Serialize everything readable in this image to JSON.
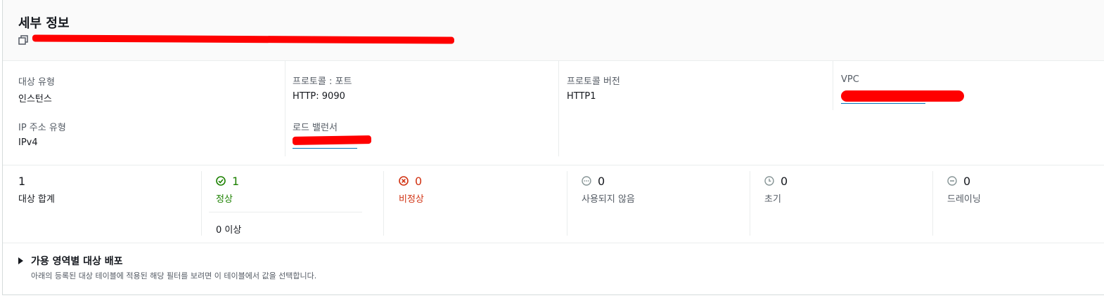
{
  "header": {
    "title": "세부 정보"
  },
  "details": {
    "target_type": {
      "label": "대상 유형",
      "value": "인스턴스"
    },
    "ip_address_type": {
      "label": "IP 주소 유형",
      "value": "IPv4"
    },
    "protocol_port": {
      "label": "프로토콜 : 포트",
      "value": "HTTP: 9090"
    },
    "load_balancer": {
      "label": "로드 밸런서"
    },
    "protocol_version": {
      "label": "프로토콜 버전",
      "value": "HTTP1"
    },
    "vpc": {
      "label": "VPC"
    }
  },
  "stats": {
    "total": {
      "count": "1",
      "label": "대상 합계"
    },
    "healthy": {
      "count": "1",
      "label": "정상",
      "sub": "0 이상",
      "color": "#1d8102"
    },
    "unhealthy": {
      "count": "0",
      "label": "비정상",
      "color": "#d13212"
    },
    "unused": {
      "count": "0",
      "label": "사용되지 않음",
      "color": "#879596"
    },
    "initial": {
      "count": "0",
      "label": "초기",
      "color": "#879596"
    },
    "draining": {
      "count": "0",
      "label": "드레이닝",
      "color": "#879596"
    }
  },
  "az_section": {
    "title": "가용 영역별 대상 배포",
    "description": "아래의 등록된 대상 테이블에 적용된 해당 필터를 보려면 이 테이블에서 값을 선택합니다."
  },
  "icons": {
    "copy": "copy-icon",
    "healthy": "check-circle-icon",
    "unhealthy": "x-circle-icon",
    "unused": "ellipsis-circle-icon",
    "initial": "clock-icon",
    "draining": "minus-circle-icon",
    "expand": "caret-right-icon"
  }
}
